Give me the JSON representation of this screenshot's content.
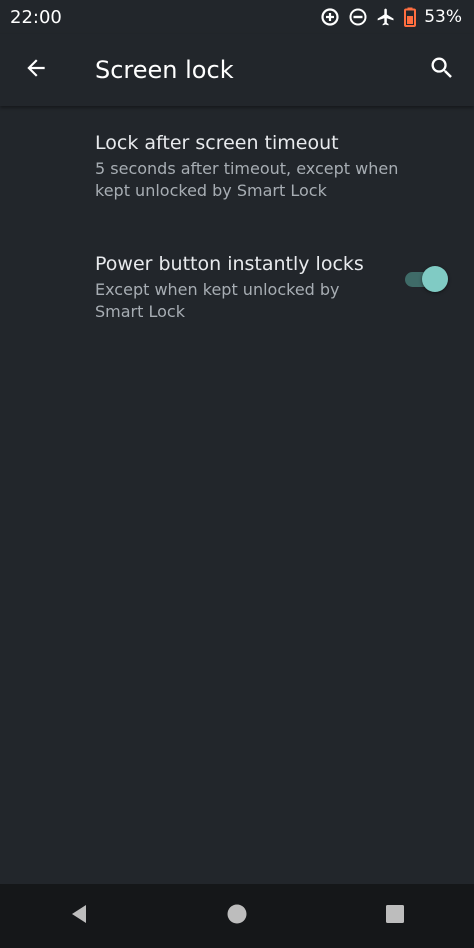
{
  "status_bar": {
    "time": "22:00",
    "battery_percent": "53%",
    "icons": [
      "data-saver-icon",
      "do-not-disturb-icon",
      "airplane-mode-icon",
      "battery-saver-icon"
    ]
  },
  "app_bar": {
    "title": "Screen lock",
    "back_icon": "arrow-back-icon",
    "search_icon": "search-icon"
  },
  "preferences": [
    {
      "title": "Lock after screen timeout",
      "summary": "5 seconds after timeout, except when kept unlocked by Smart Lock"
    },
    {
      "title": "Power button instantly locks",
      "summary": "Except when kept unlocked by Smart Lock",
      "toggle_on": true
    }
  ],
  "colors": {
    "background": "#22262b",
    "accent": "#80cbc4",
    "nav_bar": "#151719"
  },
  "nav_bar": {
    "icons": [
      "back-triangle-icon",
      "home-circle-icon",
      "recents-square-icon"
    ]
  }
}
